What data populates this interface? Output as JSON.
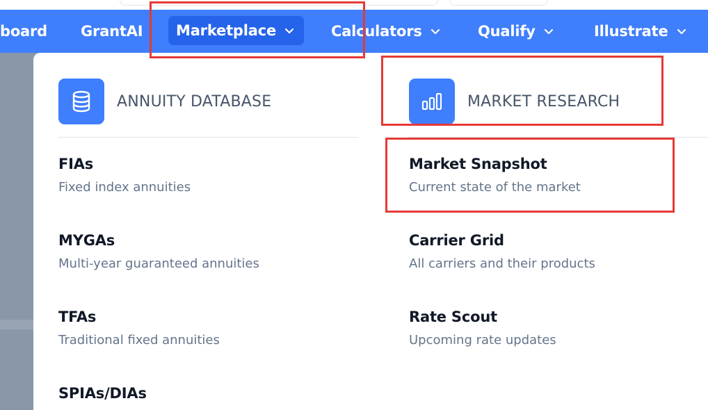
{
  "nav": {
    "items": [
      {
        "label": "board",
        "has_dropdown": false
      },
      {
        "label": "GrantAI",
        "has_dropdown": false
      },
      {
        "label": "Marketplace",
        "has_dropdown": true,
        "active": true
      },
      {
        "label": "Calculators",
        "has_dropdown": true
      },
      {
        "label": "Qualify",
        "has_dropdown": true
      },
      {
        "label": "Illustrate",
        "has_dropdown": true
      }
    ]
  },
  "menu": {
    "annuity_database": {
      "title": "ANNUITY DATABASE",
      "icon": "database-icon",
      "items": [
        {
          "title": "FIAs",
          "desc": "Fixed index annuities"
        },
        {
          "title": "MYGAs",
          "desc": "Multi-year guaranteed annuities"
        },
        {
          "title": "TFAs",
          "desc": "Traditional fixed annuities"
        },
        {
          "title": "SPIAs/DIAs",
          "desc": ""
        }
      ]
    },
    "market_research": {
      "title": "MARKET RESEARCH",
      "icon": "bar-chart-icon",
      "items": [
        {
          "title": "Market Snapshot",
          "desc": "Current state of the market"
        },
        {
          "title": "Carrier Grid",
          "desc": "All carriers and their products"
        },
        {
          "title": "Rate Scout",
          "desc": "Upcoming rate updates"
        }
      ]
    }
  },
  "colors": {
    "nav_bg": "#3f7efc",
    "nav_active_bg": "#2563eb",
    "icon_bg": "#3f7efc",
    "highlight": "#e53935",
    "backdrop": "#8a97a9"
  }
}
